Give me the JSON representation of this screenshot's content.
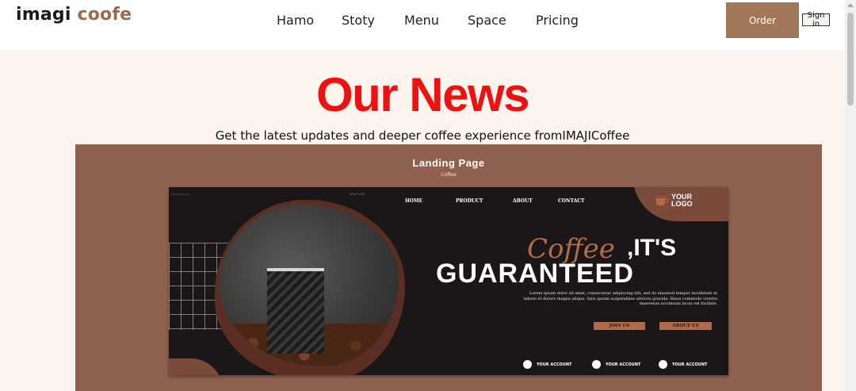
{
  "header": {
    "logo_main": "imagi",
    "logo_accent": "coofe",
    "nav": [
      "Hamo",
      "Stoty",
      "Menu",
      "Space",
      "Pricing"
    ],
    "order_label": "Order",
    "signin_label": "Sign in"
  },
  "hero": {
    "title": "Our News",
    "subtitle": "Get the latest updates and deeper coffee experience fromIMAJICoffee"
  },
  "showcase": {
    "title": "Landing Page",
    "subtitle": "Coffee",
    "mockup": {
      "nav": [
        "HOME",
        "PRODUCT",
        "ABOUT",
        "CONTACT"
      ],
      "logo_line1": "YOUR",
      "logo_line2": "LOGO",
      "headline_script": "Coffee",
      "headline_1": ",IT'S",
      "headline_2": "GUARANTEED",
      "body": "Lorem ipsum dolor sit amet, consectetur adipiscing elit, sed do eiusmod tempor incididunt ut labore et dolore magna aliqua. Quis ipsum suspendisse ultrices gravida. Risus commodo viverra maecenas accumsan lacus vel facilisis.",
      "btn_join": "JOIN US",
      "btn_about": "ABOUT US",
      "social": [
        "YOUR ACCOUNT",
        "YOUR ACCOUNT",
        "YOUR ACCOUNT"
      ]
    }
  },
  "colors": {
    "brand_brown": "#a27759",
    "title_red": "#ee1111",
    "page_bg": "#fbf5ee",
    "card_bg": "#8e6150"
  }
}
